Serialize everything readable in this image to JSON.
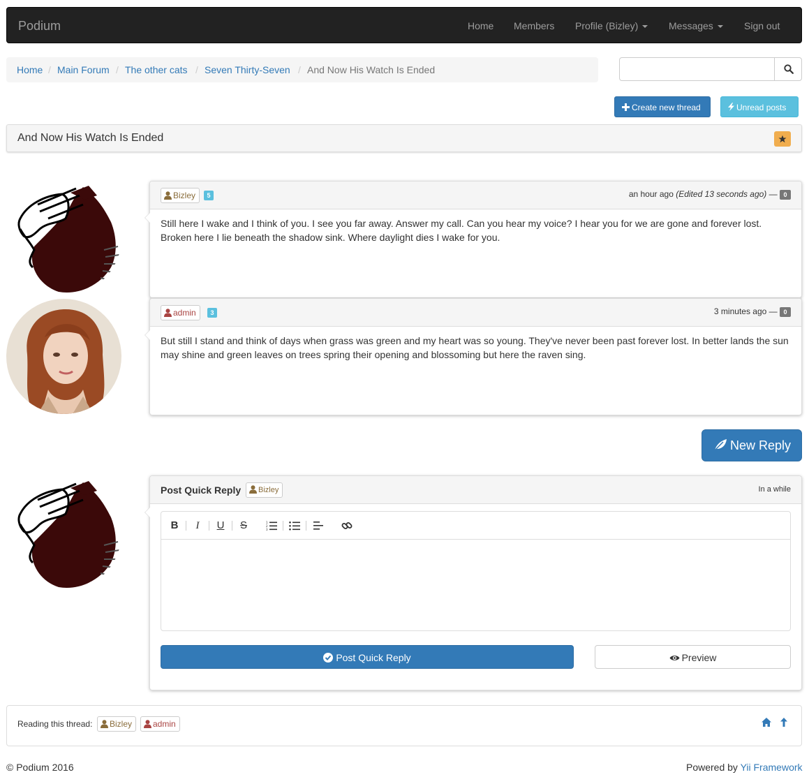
{
  "navbar": {
    "brand": "Podium",
    "items": [
      {
        "label": "Home"
      },
      {
        "label": "Members"
      },
      {
        "label": "Profile (Bizley)"
      },
      {
        "label": "Messages"
      },
      {
        "label": "Sign out"
      }
    ]
  },
  "breadcrumb": {
    "items": [
      {
        "label": "Home"
      },
      {
        "label": "Main Forum"
      },
      {
        "label": "The other cats"
      },
      {
        "label": "Seven Thirty-Seven"
      },
      {
        "label": "And Now His Watch Is Ended"
      }
    ],
    "separator": "/"
  },
  "search": {
    "value": "",
    "placeholder": "",
    "icon": "search-icon"
  },
  "actions": {
    "create_thread": "Create new thread",
    "unread_posts": "Unread posts"
  },
  "thread": {
    "title": "And Now His Watch Is Ended",
    "star_icon": "star-icon",
    "star_color": "#f0ad4e"
  },
  "posts": [
    {
      "author": "Bizley",
      "author_color": "#8a6d3b",
      "post_count": "5",
      "time": "an hour ago",
      "edited": "(Edited 13 seconds ago)",
      "dash": "—",
      "likes": "0",
      "body": "Still here I wake and I think of you. I see you far away. Answer my call. Can you hear my voice? I hear you for we are gone and forever lost. Broken here I lie beneath the shadow sink. Where daylight dies I wake for you."
    },
    {
      "author": "admin",
      "author_color": "#a94442",
      "post_count": "3",
      "time": "3 minutes ago",
      "dash": "—",
      "likes": "0",
      "body": "But still I stand and think of days when grass was green and my heart was so young. They've never been past forever lost. In better lands the sun may shine and green leaves on trees spring their opening and blossoming but here the raven sing."
    }
  ],
  "new_reply": {
    "label": "New Reply",
    "icon": "leaf-icon"
  },
  "quick_reply": {
    "title": "Post Quick Reply",
    "author": "Bizley",
    "when": "In a while",
    "toolbar": [
      "bold",
      "italic",
      "underline",
      "strikethrough",
      "ordered-list",
      "unordered-list",
      "align-left",
      "link"
    ],
    "editor_value": "",
    "submit_label": "Post Quick Reply",
    "preview_label": "Preview"
  },
  "reading": {
    "label": "Reading this thread:",
    "users": [
      {
        "name": "Bizley",
        "color": "#8a6d3b"
      },
      {
        "name": "admin",
        "color": "#a94442"
      }
    ]
  },
  "footer": {
    "copyright": "© Podium 2016",
    "powered_by": "Powered by",
    "framework": "Yii Framework"
  },
  "colors": {
    "primary": "#337ab7",
    "info": "#5bc0de",
    "navbar": "#222222",
    "warning": "#f0ad4e"
  }
}
